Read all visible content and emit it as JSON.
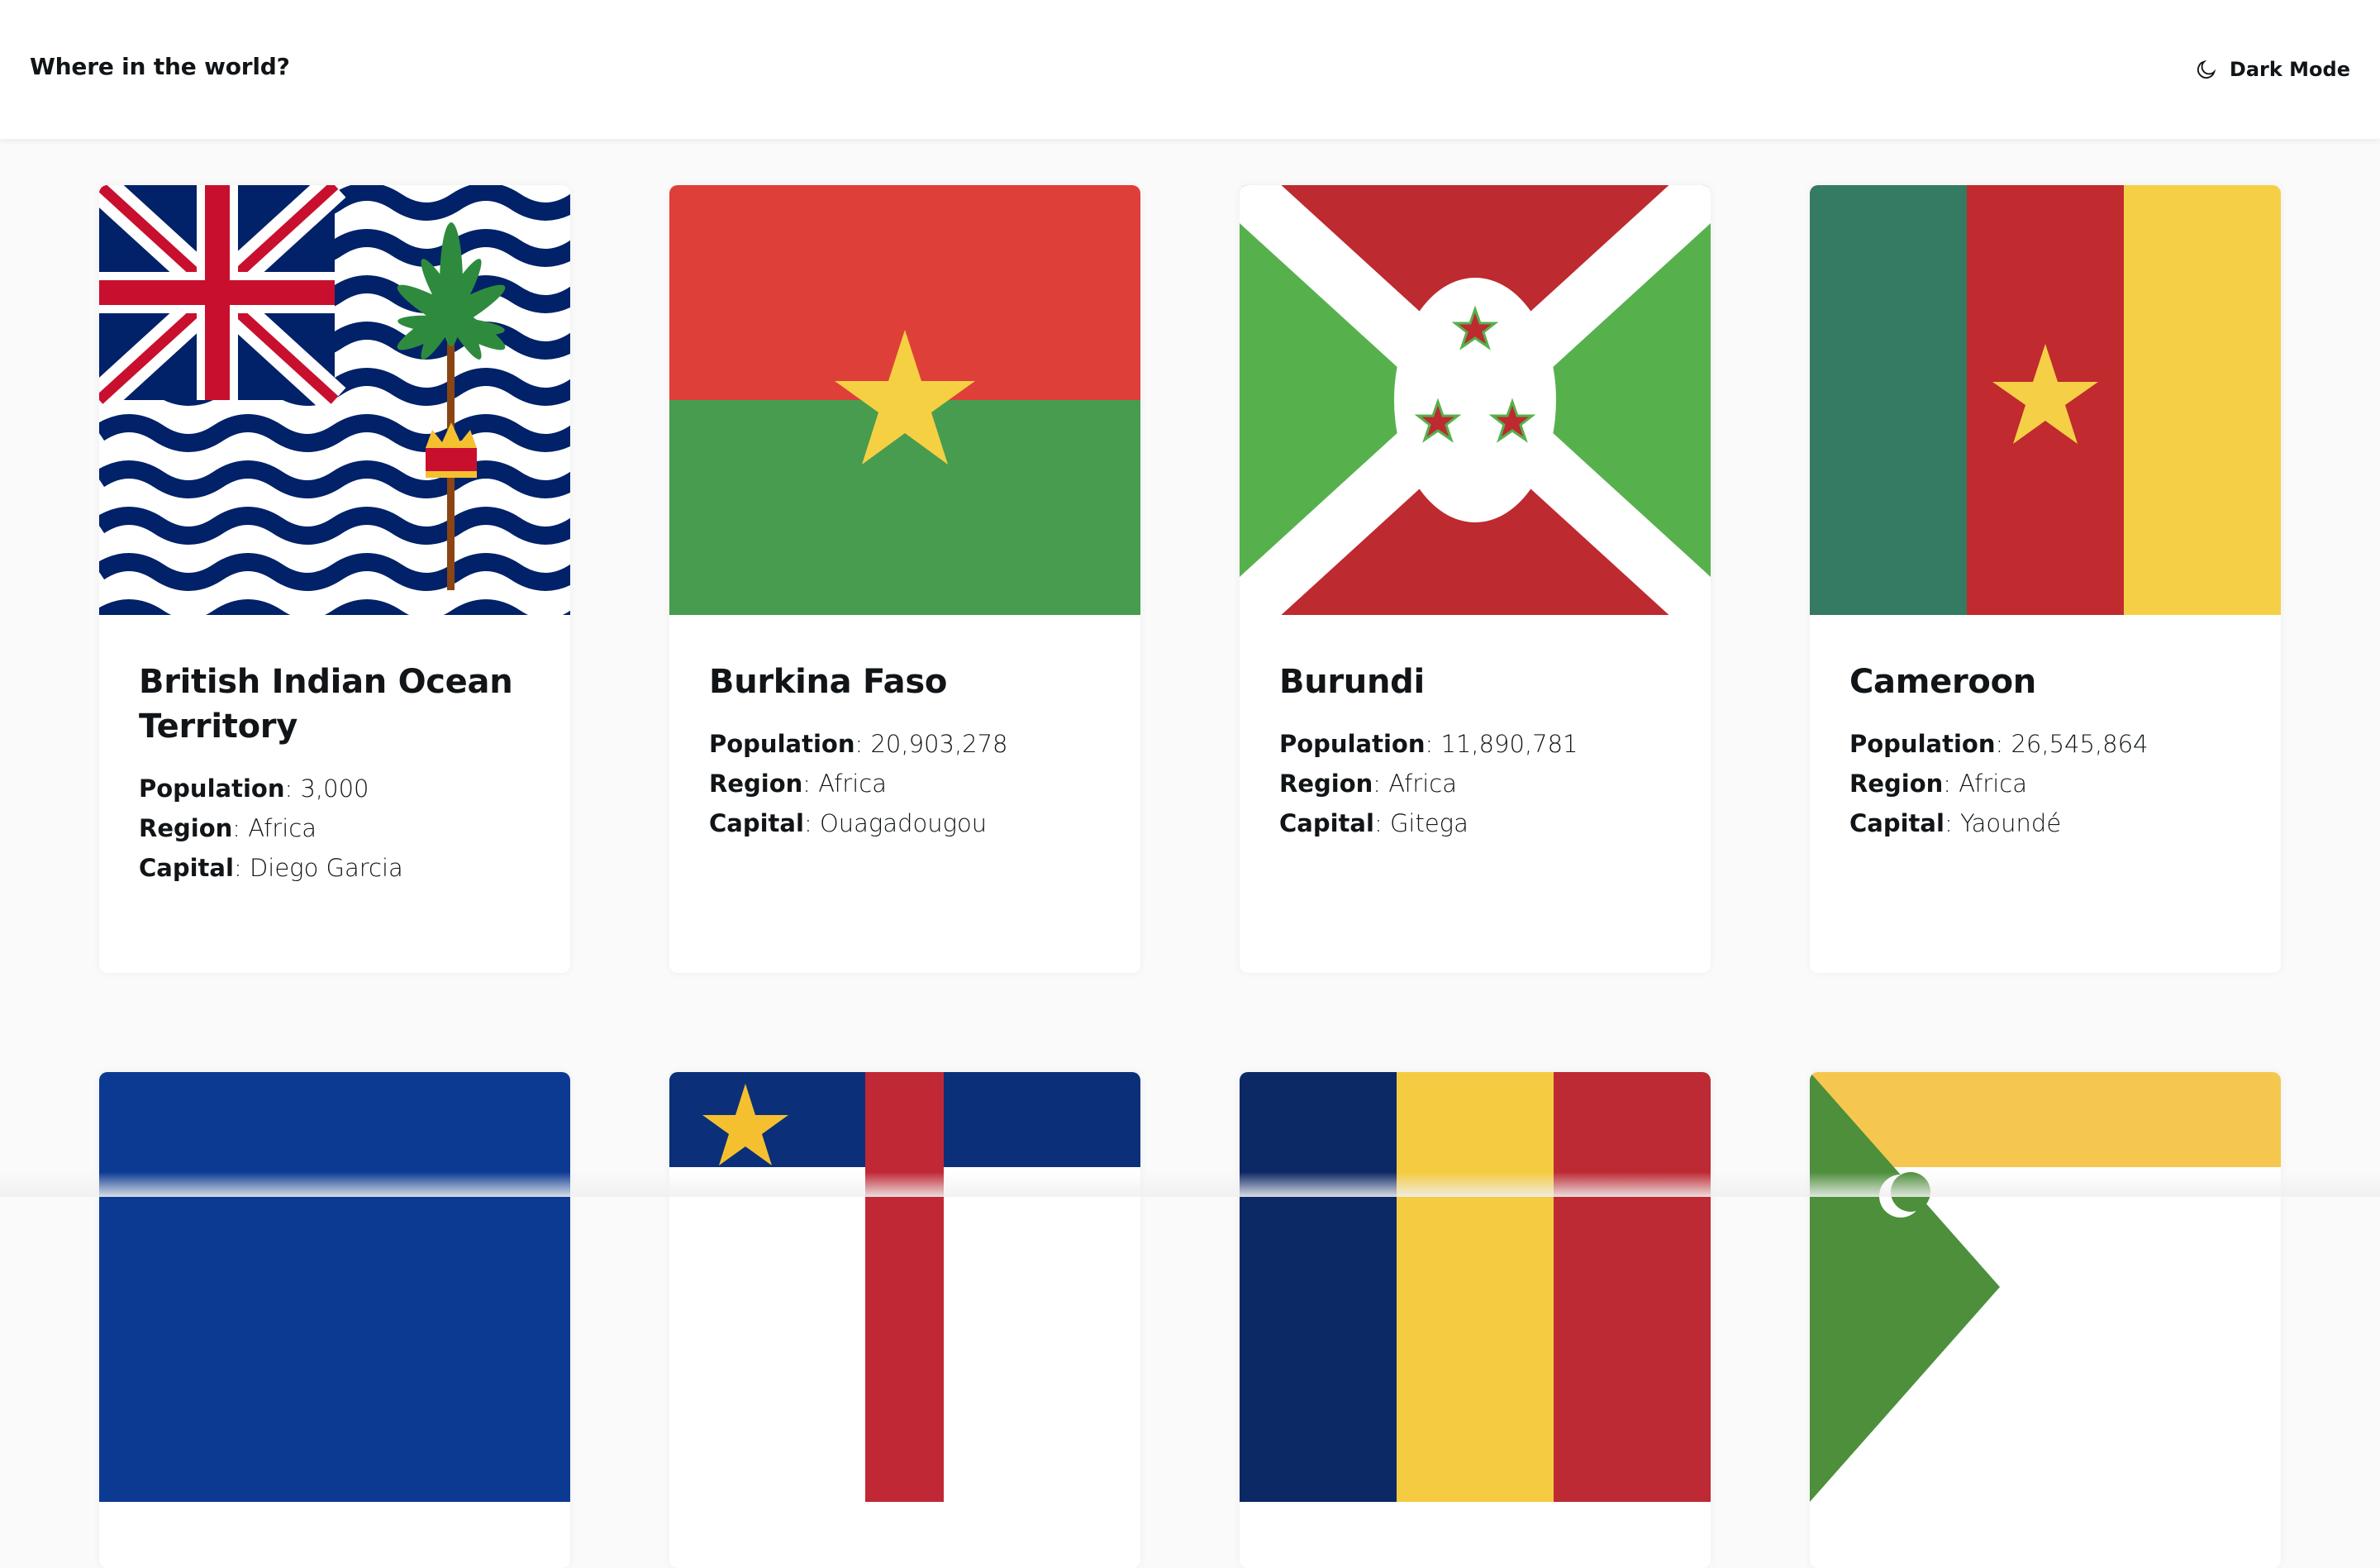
{
  "header": {
    "title": "Where in the world?",
    "mode_label": "Dark Mode",
    "mode_icon": "moon-icon"
  },
  "labels": {
    "population": "Population",
    "region": "Region",
    "capital": "Capital"
  },
  "countries": [
    {
      "name": "British Indian Ocean Territory",
      "population": "3,000",
      "region": "Africa",
      "capital": "Diego Garcia"
    },
    {
      "name": "Burkina Faso",
      "population": "20,903,278",
      "region": "Africa",
      "capital": "Ouagadougou"
    },
    {
      "name": "Burundi",
      "population": "11,890,781",
      "region": "Africa",
      "capital": "Gitega"
    },
    {
      "name": "Cameroon",
      "population": "26,545,864",
      "region": "Africa",
      "capital": "Yaoundé"
    }
  ],
  "flag_colors": {
    "british_indian_ocean_territory": [
      "#ffffff",
      "#012169",
      "#c8102e",
      "#2e8b3e",
      "#8b4513"
    ],
    "burkina_faso": [
      "#de4039",
      "#479c4f",
      "#f5d043"
    ],
    "burundi": [
      "#bd2a30",
      "#56b14d",
      "#ffffff"
    ],
    "cameroon": [
      "#357a62",
      "#c12a2e",
      "#f5d046"
    ],
    "cabo_verde": [
      "#0c3a93"
    ],
    "central_african_republic": [
      "#0b3079",
      "#ffffff",
      "#c02836",
      "#f5c030"
    ],
    "chad": [
      "#0c2865",
      "#f5cb41",
      "#be2a34"
    ],
    "comoros": [
      "#f5c74f",
      "#ffffff",
      "#4d8f3b"
    ]
  }
}
